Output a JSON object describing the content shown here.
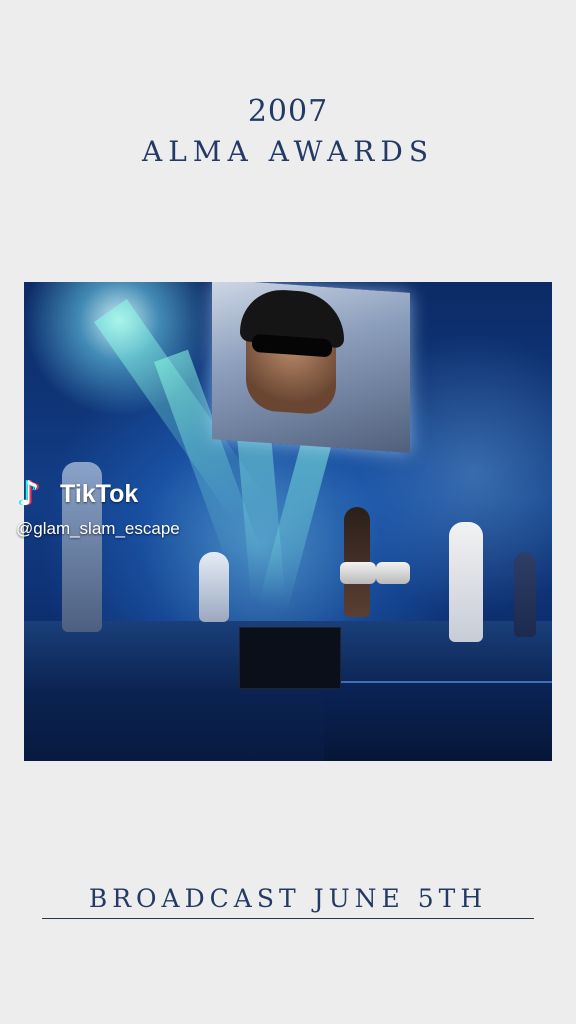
{
  "header": {
    "year": "2007",
    "title": "ALMA AWARDS"
  },
  "video": {
    "description_icon": "concert-video-frame"
  },
  "watermark": {
    "brand": "TikTok",
    "handle": "@glam_slam_escape"
  },
  "footer": {
    "caption": "BROADCAST JUNE 5TH"
  }
}
